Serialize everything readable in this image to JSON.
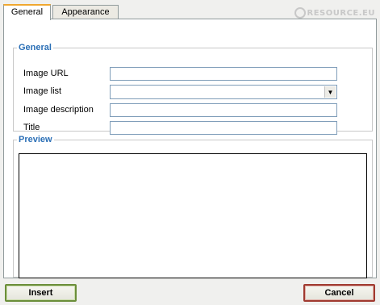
{
  "tabs": [
    {
      "label": "General",
      "active": true
    },
    {
      "label": "Appearance",
      "active": false
    }
  ],
  "brand": "RESOURCE.EU",
  "general": {
    "legend": "General",
    "fields": {
      "image_url": {
        "label": "Image URL",
        "value": ""
      },
      "image_list": {
        "label": "Image list",
        "value": ""
      },
      "image_description": {
        "label": "Image description",
        "value": ""
      },
      "title": {
        "label": "Title",
        "value": ""
      }
    }
  },
  "preview": {
    "legend": "Preview"
  },
  "buttons": {
    "insert": "Insert",
    "cancel": "Cancel"
  },
  "colors": {
    "legend": "#2b6fb6",
    "active_tab_accent": "#f0a830",
    "insert_border": "#6b8e3a",
    "cancel_border": "#a03a30"
  },
  "icons": {
    "select_arrow": "chevron-down-icon"
  }
}
